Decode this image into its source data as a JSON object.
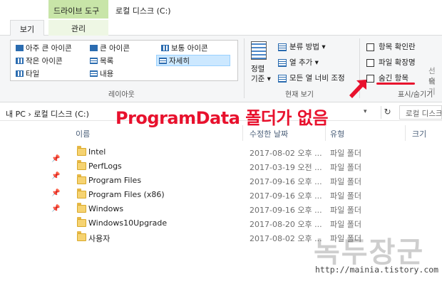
{
  "window": {
    "context_tab": "드라이브 도구",
    "title": "로컬 디스크 (C:)"
  },
  "tabs": {
    "view": "보기",
    "manage": "관리"
  },
  "ribbon": {
    "layout": {
      "items": [
        {
          "label": "아주 큰 아이콘"
        },
        {
          "label": "큰 아이콘"
        },
        {
          "label": "보통 아이콘"
        },
        {
          "label": "작은 아이콘"
        },
        {
          "label": "목록"
        },
        {
          "label": "자세히"
        },
        {
          "label": "타일"
        },
        {
          "label": "내용"
        }
      ],
      "selected": "자세히",
      "group_label": "레이아웃"
    },
    "current_view": {
      "sort_label_line1": "정렬",
      "sort_label_line2": "기준",
      "group_by": "분류 방법",
      "add_columns": "열 추가",
      "size_all_columns": "모든 열 너비 조정",
      "group_label": "현재 보기"
    },
    "show_hide": {
      "item_checkboxes": "항목 확인란",
      "file_extensions": "파일 확장명",
      "hidden_items": "숨긴 항목",
      "cut_label_1": "선택",
      "cut_label_2": "숨기",
      "group_label": "표시/숨기기"
    }
  },
  "address": {
    "path": "내 PC  ›  로컬 디스크 (C:)",
    "search_placeholder": "로컬 디스크"
  },
  "annotation_text": "ProgramData 폴더가 없음",
  "columns": {
    "name": "이름",
    "modified": "수정한 날짜",
    "type": "유형",
    "size": "크기"
  },
  "files": [
    {
      "name": "Intel",
      "date": "2017-08-02 오후 ...",
      "type": "파일 폴더"
    },
    {
      "name": "PerfLogs",
      "date": "2017-03-19 오전 ...",
      "type": "파일 폴더"
    },
    {
      "name": "Program Files",
      "date": "2017-09-16 오후 ...",
      "type": "파일 폴더"
    },
    {
      "name": "Program Files (x86)",
      "date": "2017-09-16 오후 ...",
      "type": "파일 폴더"
    },
    {
      "name": "Windows",
      "date": "2017-09-16 오후 ...",
      "type": "파일 폴더"
    },
    {
      "name": "Windows10Upgrade",
      "date": "2017-08-20 오후 ...",
      "type": "파일 폴더"
    },
    {
      "name": "사용자",
      "date": "2017-08-02 오후 ...",
      "type": "파일 폴더"
    }
  ],
  "watermark": {
    "text": "녹두장군",
    "url": "http://mainia.tistory.com"
  },
  "colors": {
    "annotation": "#e8112d",
    "context_tab": "#c8e5a8",
    "selection": "#cce8ff",
    "folder": "#f6d371"
  }
}
